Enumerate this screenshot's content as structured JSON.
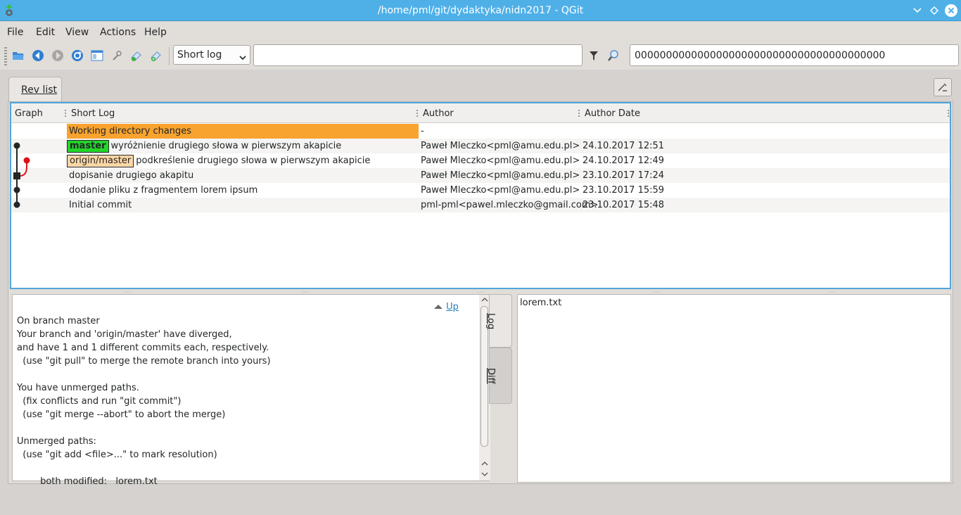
{
  "window": {
    "title": "/home/pml/git/dydaktyka/nidn2017 - QGit"
  },
  "menu": [
    "File",
    "Edit",
    "View",
    "Actions",
    "Help"
  ],
  "toolbar": {
    "icons": [
      "open-folder-icon",
      "back-icon",
      "forward-icon",
      "refresh-icon",
      "view-icon",
      "tools-icon",
      "patch-apply-icon",
      "patch-format-icon"
    ],
    "view_select": "Short log",
    "filter_value": "",
    "sha_value": "0000000000000000000000000000000000000000"
  },
  "tabs": {
    "rev_list": "Rev list"
  },
  "revlist": {
    "headers": {
      "graph": "Graph",
      "short_log": "Short Log",
      "author": "Author",
      "author_date": "Author Date"
    },
    "rows": [
      {
        "ref": "",
        "log": "Working directory changes",
        "author": "-",
        "date": ""
      },
      {
        "ref": "master",
        "log": "wyróżnienie drugiego słowa w pierwszym akapicie",
        "author": "Paweł Mleczko<pml@amu.edu.pl>",
        "date": "24.10.2017 12:51"
      },
      {
        "ref": "origin/master",
        "log": "podkreślenie drugiego słowa w pierwszym akapicie",
        "author": "Paweł Mleczko<pml@amu.edu.pl>",
        "date": "24.10.2017 12:49"
      },
      {
        "ref": "",
        "log": "dopisanie drugiego akapitu",
        "author": "Paweł Mleczko<pml@amu.edu.pl>",
        "date": "23.10.2017 17:24"
      },
      {
        "ref": "",
        "log": "dodanie pliku z fragmentem lorem ipsum",
        "author": "Paweł Mleczko<pml@amu.edu.pl>",
        "date": "23.10.2017 15:59"
      },
      {
        "ref": "",
        "log": "Initial commit",
        "author": "pml-pml<pawel.mleczko@gmail.com>",
        "date": "23.10.2017 15:48"
      }
    ]
  },
  "log_panel": {
    "up_label": "Up",
    "text": "On branch master\nYour branch and 'origin/master' have diverged,\nand have 1 and 1 different commits each, respectively.\n  (use \"git pull\" to merge the remote branch into yours)\n\nYou have unmerged paths.\n  (fix conflicts and run \"git commit\")\n  (use \"git merge --abort\" to abort the merge)\n\nUnmerged paths:\n  (use \"git add <file>...\" to mark resolution)\n\n\tboth modified:   lorem.txt"
  },
  "side_tabs": {
    "log": "Log",
    "diff": "Diff"
  },
  "files": [
    "lorem.txt"
  ],
  "colors": {
    "titlebar": "#4fb0e8",
    "working_dir": "#f8a32f",
    "master_badge": "#23d62a",
    "origin_badge": "#ffd7a6",
    "graph_red": "#e0101a"
  }
}
